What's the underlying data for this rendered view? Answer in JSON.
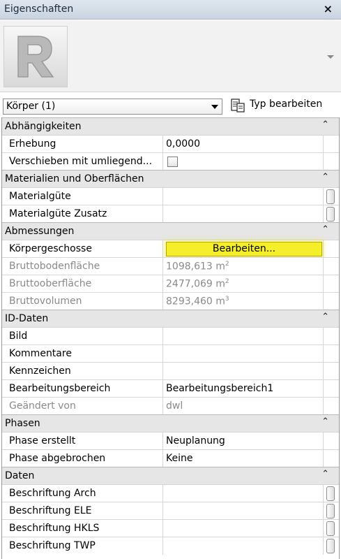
{
  "window": {
    "title": "Eigenschaften",
    "close_glyph": "×"
  },
  "preview": {
    "logo_letter": "R",
    "logo_icon": "revit-logo-icon"
  },
  "type_selector": {
    "value": "Körper (1)"
  },
  "edit_type": {
    "label": "Typ bearbeiten",
    "icon": "edit-type-icon"
  },
  "colors": {
    "highlight_button": "#f4ef2a",
    "group_bg": "#e6e6e6",
    "readonly_text": "#8a8a8a"
  },
  "groups": [
    {
      "name": "Abhängigkeiten",
      "rows": [
        {
          "name": "Erhebung",
          "value": "0,0000"
        },
        {
          "name": "Verschieben mit umliegend...",
          "value": "",
          "checkbox": true
        }
      ]
    },
    {
      "name": "Materialien und Oberflächen",
      "rows": [
        {
          "name": "Materialgüte",
          "value": ""
        },
        {
          "name": "Materialgüte Zusatz",
          "value": ""
        }
      ]
    },
    {
      "name": "Abmessungen",
      "rows": [
        {
          "name": "Körpergeschosse",
          "button": "Bearbeiten..."
        },
        {
          "name": "Bruttobodenfläche",
          "value": "1098,613 m",
          "sup": "2",
          "readonly": true
        },
        {
          "name": "Bruttooberfläche",
          "value": "2477,069 m",
          "sup": "2",
          "readonly": true
        },
        {
          "name": "Bruttovolumen",
          "value": "8293,460 m",
          "sup": "3",
          "readonly": true
        }
      ]
    },
    {
      "name": "ID-Daten",
      "rows": [
        {
          "name": "Bild",
          "value": ""
        },
        {
          "name": "Kommentare",
          "value": ""
        },
        {
          "name": "Kennzeichen",
          "value": ""
        },
        {
          "name": "Bearbeitungsbereich",
          "value": "Bearbeitungsbereich1"
        },
        {
          "name": "Geändert von",
          "value": "dwl",
          "readonly": true
        }
      ]
    },
    {
      "name": "Phasen",
      "rows": [
        {
          "name": "Phase erstellt",
          "value": "Neuplanung"
        },
        {
          "name": "Phase abgebrochen",
          "value": "Keine"
        }
      ]
    },
    {
      "name": "Daten",
      "rows": [
        {
          "name": "Beschriftung Arch",
          "value": ""
        },
        {
          "name": "Beschriftung ELE",
          "value": ""
        },
        {
          "name": "Beschriftung HKLS",
          "value": ""
        },
        {
          "name": "Beschriftung TWP",
          "value": ""
        }
      ]
    }
  ]
}
